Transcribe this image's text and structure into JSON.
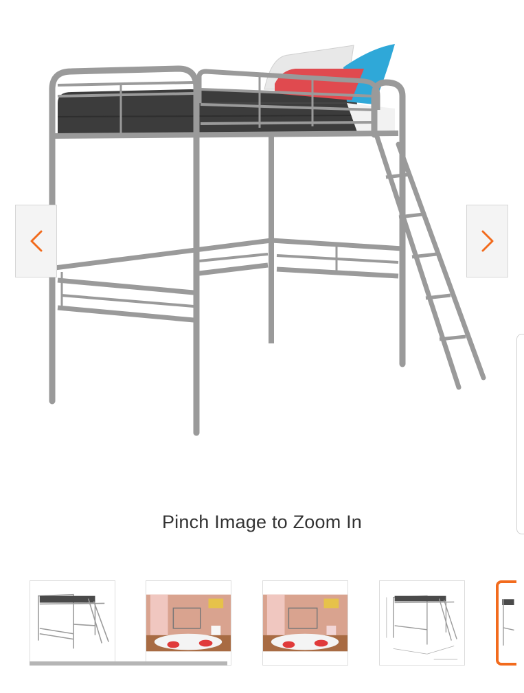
{
  "gallery": {
    "main_image": {
      "icon": "loft-bed-photo",
      "alt": "Metal loft bed with ladder"
    },
    "prev_icon": "chevron-left-icon",
    "next_icon": "chevron-right-icon",
    "accent_color": "#f26b1d",
    "zoom_hint": "Pinch Image to Zoom In",
    "thumbnails": [
      {
        "icon": "loft-bed-thumbnail"
      },
      {
        "icon": "bedroom-scene-thumbnail"
      },
      {
        "icon": "bedroom-scene-thumbnail"
      },
      {
        "icon": "dimensions-diagram-thumbnail"
      },
      {
        "icon": "loft-bed-thumbnail",
        "selected": true
      }
    ]
  }
}
